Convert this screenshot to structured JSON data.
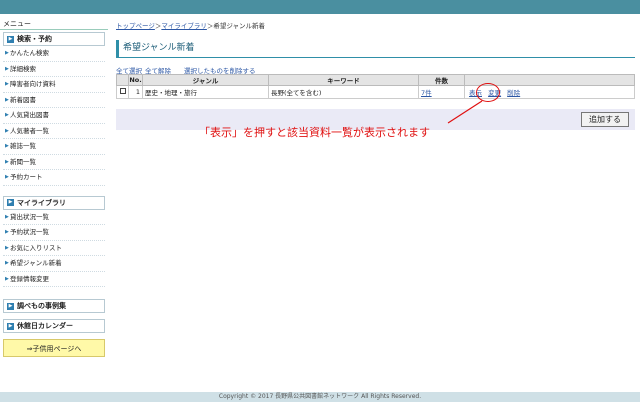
{
  "sidebar": {
    "title": "メニュー",
    "sections": [
      {
        "heading": "検索・予約",
        "items": [
          "かんたん検索",
          "詳細検索",
          "障害者向け資料",
          "新着図書",
          "人気貸出図書",
          "人気著者一覧",
          "雑誌一覧",
          "新聞一覧",
          "予約カート"
        ]
      },
      {
        "heading": "マイライブラリ",
        "items": [
          "貸出状況一覧",
          "予約状況一覧",
          "お気に入りリスト",
          "希望ジャンル新着",
          "登録情報変更"
        ]
      },
      {
        "heading": "調べもの事例集",
        "items": []
      },
      {
        "heading": "休館日カレンダー",
        "items": []
      }
    ],
    "kids_link": "⇒子供用ページへ"
  },
  "breadcrumb": {
    "home": "トップページ",
    "sep1": "＞",
    "mylib": "マイライブラリ",
    "sep2": "＞",
    "current": "希望ジャンル新着"
  },
  "page_title": "希望ジャンル新着",
  "actions": {
    "select_all": "全て選択",
    "deselect_all": "全て解除",
    "delete_selected": "選択したものを削除する"
  },
  "table": {
    "headers": {
      "no": "No.",
      "genre": "ジャンル",
      "keyword": "キーワード",
      "count": "件数"
    },
    "rows": [
      {
        "no": "1",
        "genre": "歴史・地理・旅行",
        "keyword": "長野(全てを含む)",
        "count": "7件",
        "show": "表示",
        "edit": "変更",
        "delete": "削除"
      }
    ]
  },
  "add_button": "追加する",
  "annotation": "「表示」を押すと該当資料一覧が表示されます",
  "footer": "Copyright © 2017 長野県公共図書館ネットワーク All Rights Reserved.",
  "colors": {
    "topbar": "#4a8fa0",
    "accent": "#2f8fa8",
    "annotation": "#e01010",
    "kids_bg": "#fff9a8"
  }
}
